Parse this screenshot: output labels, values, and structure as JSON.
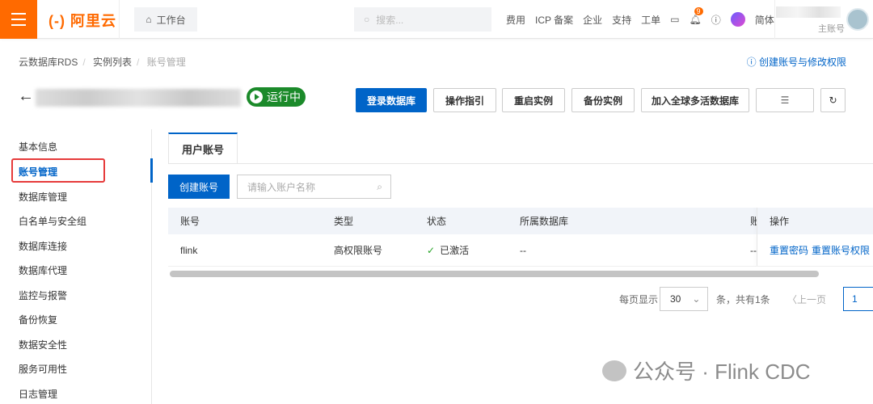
{
  "header": {
    "logo": "(-) 阿里云",
    "workbench": "工作台",
    "search_placeholder": "搜索...",
    "nav": [
      "费用",
      "ICP 备案",
      "企业",
      "支持",
      "工单"
    ],
    "notif_count": "9",
    "lang": "简体",
    "account_type": "主账号"
  },
  "breadcrumb": [
    "云数据库RDS",
    "实例列表",
    "账号管理"
  ],
  "help_link": "创建账号与修改权限",
  "status": "运行中",
  "actions": [
    "登录数据库",
    "操作指引",
    "重启实例",
    "备份实例",
    "加入全球多活数据库"
  ],
  "sidebar": [
    "基本信息",
    "账号管理",
    "数据库管理",
    "白名单与安全组",
    "数据库连接",
    "数据库代理",
    "监控与报警",
    "备份恢复",
    "数据安全性",
    "服务可用性",
    "日志管理"
  ],
  "tab": "用户账号",
  "create_button": "创建账号",
  "input_placeholder": "请输入账户名称",
  "table": {
    "columns": [
      "账号",
      "类型",
      "状态",
      "所属数据库",
      "账",
      "操作"
    ],
    "rows": [
      {
        "account": "flink",
        "type": "高权限账号",
        "status": "已激活",
        "db": "--",
        "desc": "--",
        "op1": "重置密码",
        "op2": "重置账号权限"
      }
    ]
  },
  "pagination": {
    "per_page_label": "每页显示",
    "per_page": "30",
    "total": "条，共有1条",
    "prev": "上一页",
    "page": "1"
  },
  "watermark": "公众号 · Flink CDC",
  "colors": {
    "brand": "#ff6a00",
    "primary": "#0064c8",
    "running": "#1b8a2a"
  }
}
